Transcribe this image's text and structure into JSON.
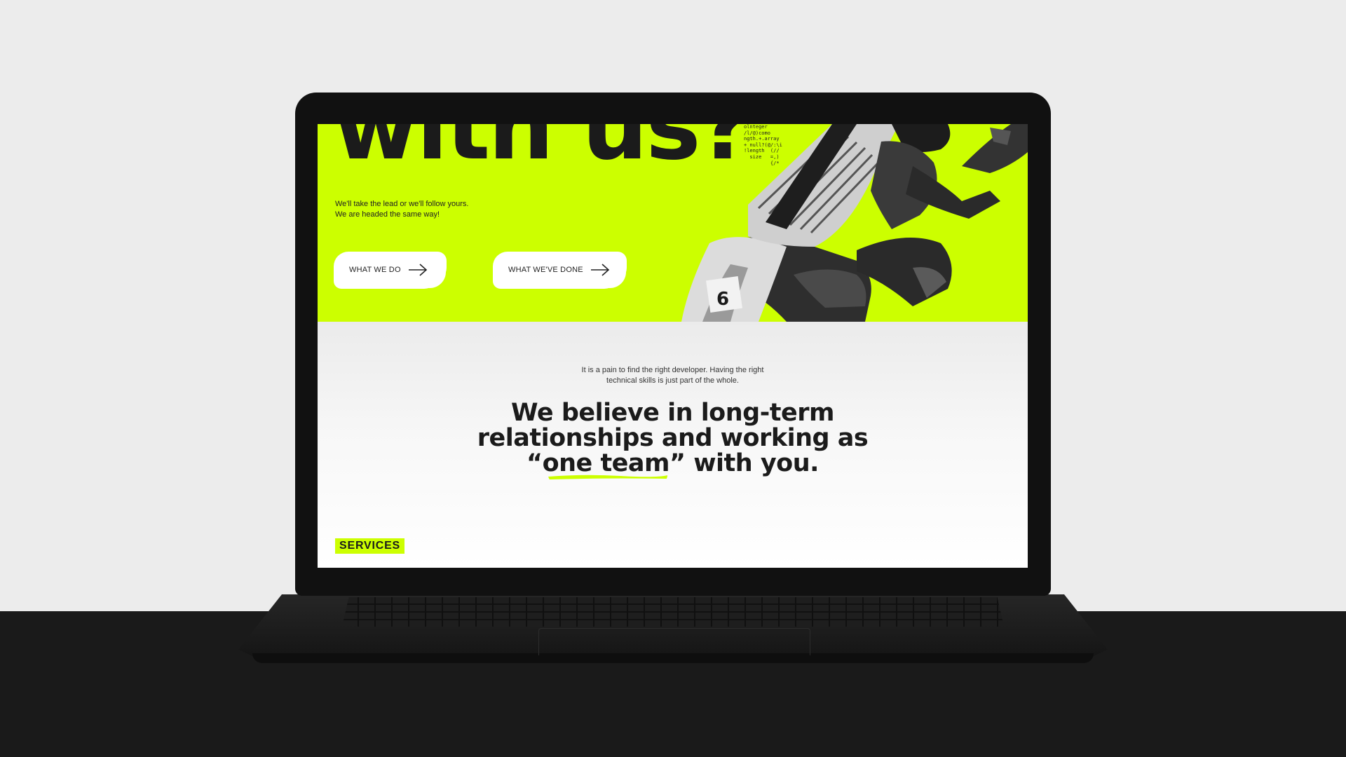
{
  "hero": {
    "title": "with us?",
    "subtitle_lines": [
      "We'll take the lead or we'll follow yours.",
      "We are headed the same way!"
    ],
    "buttons": [
      {
        "label": "WHAT WE DO",
        "icon": "arrow-right-icon"
      },
      {
        "label": "WHAT WE'VE DONE",
        "icon": "arrow-right-icon"
      }
    ],
    "code_snippet": "olnteger\n/l/@)como\nngth.+.array\n+ null?(@/:\\i\n!length  (//\n  size   =,)\n         {/*",
    "bib_number": "6",
    "accent_color": "#ccff00"
  },
  "main": {
    "intro_lines": [
      "It is a pain to find the right developer. Having the right",
      "technical skills is just part of the whole."
    ],
    "headline": {
      "line1": "We believe in long-term",
      "line2": "relationships and working as",
      "line3_prefix": "“",
      "line3_highlight": "one team",
      "line3_suffix": "” with you."
    },
    "section_label": "SERVICES"
  }
}
